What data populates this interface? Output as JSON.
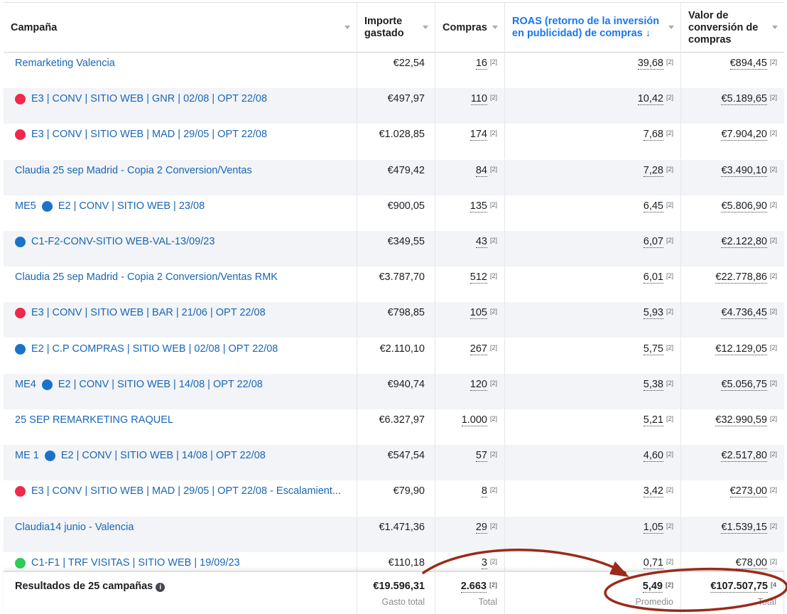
{
  "columns": {
    "campaign": "Campaña",
    "spend": "Importe gastado",
    "purchases": "Compras",
    "roas": "ROAS (retorno de la inversión en publicidad) de compras ↓",
    "value": "Valor de conversión de compras"
  },
  "ref_mark": "[2]",
  "ref_mark_truncated": "[4",
  "status_colors": {
    "red": "#f02849",
    "blue": "#1a73c8",
    "green": "#2ecc55"
  },
  "rows": [
    {
      "prefix": "",
      "dot": "",
      "name": "Remarketing Valencia",
      "spend": "€22,54",
      "purchases": "16",
      "roas": "39,68",
      "value": "€894,45"
    },
    {
      "prefix": "",
      "dot": "red",
      "name": "E3 | CONV | SITIO WEB | GNR | 02/08 | OPT 22/08",
      "spend": "€497,97",
      "purchases": "110",
      "roas": "10,42",
      "value": "€5.189,65"
    },
    {
      "prefix": "",
      "dot": "red",
      "name": "E3 | CONV | SITIO WEB | MAD | 29/05 | OPT 22/08",
      "spend": "€1.028,85",
      "purchases": "174",
      "roas": "7,68",
      "value": "€7.904,20"
    },
    {
      "prefix": "",
      "dot": "",
      "name": "Claudia 25 sep Madrid - Copia 2 Conversion/Ventas",
      "spend": "€479,42",
      "purchases": "84",
      "roas": "7,28",
      "value": "€3.490,10"
    },
    {
      "prefix": "ME5",
      "dot": "blue",
      "name": "E2 | CONV | SITIO WEB | 23/08",
      "spend": "€900,05",
      "purchases": "135",
      "roas": "6,45",
      "value": "€5.806,90"
    },
    {
      "prefix": "",
      "dot": "blue",
      "name": "C1-F2-CONV-SITIO WEB-VAL-13/09/23",
      "spend": "€349,55",
      "purchases": "43",
      "roas": "6,07",
      "value": "€2.122,80"
    },
    {
      "prefix": "",
      "dot": "",
      "name": "Claudia 25 sep Madrid - Copia 2 Conversion/Ventas RMK",
      "spend": "€3.787,70",
      "purchases": "512",
      "roas": "6,01",
      "value": "€22.778,86"
    },
    {
      "prefix": "",
      "dot": "red",
      "name": "E3 | CONV | SITIO WEB | BAR | 21/06 | OPT 22/08",
      "spend": "€798,85",
      "purchases": "105",
      "roas": "5,93",
      "value": "€4.736,45"
    },
    {
      "prefix": "",
      "dot": "blue",
      "name": "E2 | C.P COMPRAS | SITIO WEB | 02/08 | OPT 22/08",
      "spend": "€2.110,10",
      "purchases": "267",
      "roas": "5,75",
      "value": "€12.129,05"
    },
    {
      "prefix": "ME4",
      "dot": "blue",
      "name": "E2 | CONV | SITIO WEB | 14/08 | OPT 22/08",
      "spend": "€940,74",
      "purchases": "120",
      "roas": "5,38",
      "value": "€5.056,75"
    },
    {
      "prefix": "",
      "dot": "",
      "name": "25 SEP REMARKETING RAQUEL",
      "spend": "€6.327,97",
      "purchases": "1.000",
      "roas": "5,21",
      "value": "€32.990,59"
    },
    {
      "prefix": "ME 1",
      "dot": "blue",
      "name": "E2 | CONV | SITIO WEB | 14/08 | OPT 22/08",
      "spend": "€547,54",
      "purchases": "57",
      "roas": "4,60",
      "value": "€2.517,80"
    },
    {
      "prefix": "",
      "dot": "red",
      "name": "E3 | CONV | SITIO WEB | MAD | 29/05 | OPT 22/08 - Escalamient...",
      "spend": "€79,90",
      "purchases": "8",
      "roas": "3,42",
      "value": "€273,00"
    },
    {
      "prefix": "",
      "dot": "",
      "name": "Claudia14 junio - Valencia",
      "spend": "€1.471,36",
      "purchases": "29",
      "roas": "1,05",
      "value": "€1.539,15"
    },
    {
      "prefix": "",
      "dot": "green",
      "name": "C1-F1 | TRF VISITAS | SITIO WEB | 19/09/23",
      "spend": "€110,18",
      "purchases": "3",
      "roas": "0,71",
      "value": "€78,00"
    }
  ],
  "footer": {
    "label": "Resultados de 25 campañas",
    "info_icon": "i",
    "spend": "€19.596,31",
    "spend_sub": "Gasto total",
    "purchases": "2.663",
    "purchases_sub": "Total",
    "roas": "5,49",
    "roas_sub": "Promedio",
    "value": "€107.507,75",
    "value_sub": "Total"
  },
  "annotation_color": "#9b2a1a"
}
